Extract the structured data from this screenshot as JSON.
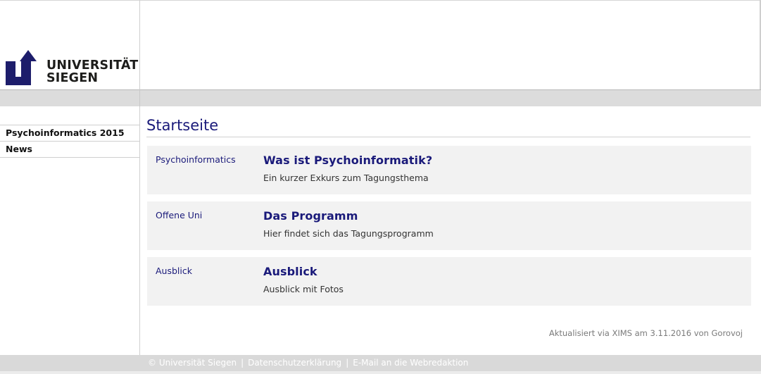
{
  "header": {
    "logo_line1": "UNIVERSITÄT",
    "logo_line2": "SIEGEN",
    "logo_color": "#1d1d6b"
  },
  "sidebar": {
    "items": [
      {
        "label": "Psychoinformatics 2015"
      },
      {
        "label": "News"
      }
    ]
  },
  "main": {
    "title": "Startseite",
    "teasers": [
      {
        "category": "Psychoinformatics",
        "headline": "Was ist Psychoinformatik?",
        "text": "Ein kurzer Exkurs zum Tagungsthema"
      },
      {
        "category": "Offene Uni",
        "headline": "Das Programm",
        "text": "Hier findet sich das Tagungsprogramm"
      },
      {
        "category": "Ausblick",
        "headline": "Ausblick",
        "text": "Ausblick mit Fotos"
      }
    ],
    "updated": {
      "prefix": "Aktualisiert via",
      "system": "XIMS",
      "date_text": "am 3.11.2016 von",
      "author": "Gorovoj"
    }
  },
  "footer": {
    "copyright": "© Universität Siegen",
    "privacy": "Datenschutzerklärung",
    "contact": "E-Mail an die Webredaktion",
    "separator": "|"
  },
  "colors": {
    "accent": "#1a1a7a",
    "band": "#dcdcdc",
    "teaser_bg": "#f2f2f2"
  }
}
